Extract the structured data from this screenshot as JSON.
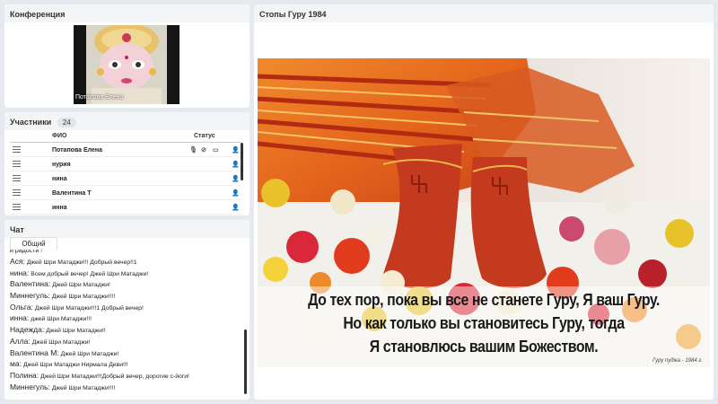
{
  "conference": {
    "title": "Конференция",
    "video_name": "Потапова Елена"
  },
  "participants": {
    "title": "Участники",
    "count": "24",
    "col_fio": "ФИО",
    "col_status": "Статус",
    "rows": [
      {
        "name": "Потапова Елена"
      },
      {
        "name": "нурия"
      },
      {
        "name": "нина"
      },
      {
        "name": "Валентина Т"
      },
      {
        "name": "инна"
      }
    ]
  },
  "chat": {
    "title": "Чат",
    "tab": "Общий",
    "partial_line": "и радости !",
    "messages": [
      {
        "author": "Ася:",
        "text": "Джей Шри Матаджи!!! Добрый вечер!!1"
      },
      {
        "author": "нина:",
        "text": "Всем добрый вечер!   Джей Шри Матаджи!"
      },
      {
        "author": "Валентина:",
        "text": "Джей Шри Матаджи!"
      },
      {
        "author": "Миннегуль:",
        "text": "Джей Шри Матаджи!!!!"
      },
      {
        "author": "Ольга:",
        "text": "Джей Шри Матаджи!!!1 Добрый вечер!"
      },
      {
        "author": "инна:",
        "text": "джей Шри Матаджи!!!"
      },
      {
        "author": "Надежда:",
        "text": "Джей  Шри Матаджи!!"
      },
      {
        "author": "Алла:",
        "text": "Джей Шри Матаджи!"
      },
      {
        "author": "Валентина  М:",
        "text": "Джей  Шри    Матаджи!"
      },
      {
        "author": "ма:",
        "text": "Джей  Шри Матаджи Нирмала Деви!!!"
      },
      {
        "author": "Полина:",
        "text": "Джей Шри Матаджи!!!Добрый вечер, дорогие с-йоги!"
      },
      {
        "author": "Миннегуль:",
        "text": "Джей Шри Матаджи!!!!"
      }
    ]
  },
  "main": {
    "title": "Стопы Гуру 1984",
    "caption_line1": "До тех пор, пока вы все не станете Гуру, Я ваш Гуру.",
    "caption_line2": "Но как только вы становитесь Гуру, тогда",
    "caption_line3": "Я становлюсь вашим Божеством.",
    "signature": "Гуру пуджа - 1984 г."
  },
  "colors": {
    "panel_bg": "#ffffff",
    "page_bg": "#e6e9ee",
    "sari_orange": "#e4641c",
    "sari_red": "#b8200a",
    "feet_red": "#c43a1e"
  }
}
